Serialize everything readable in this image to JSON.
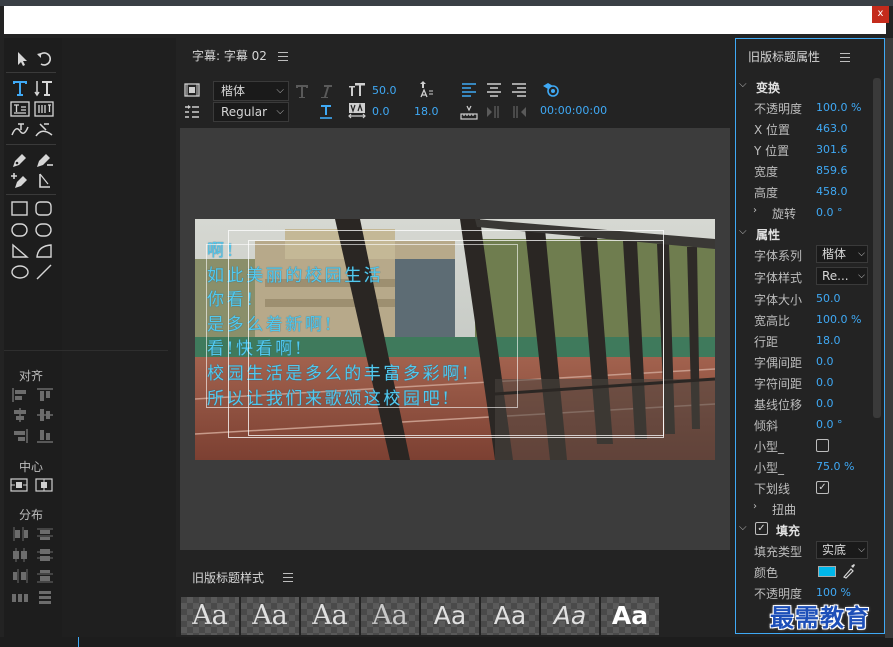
{
  "window": {
    "close_label": "x"
  },
  "editor": {
    "tab_label": "字幕: 字幕 02",
    "font_family": "楷体",
    "font_style": "Regular",
    "font_size": "50.0",
    "kerning": "0.0",
    "leading": "18.0",
    "timecode": "00:00:00:00"
  },
  "subtitle_lines": [
    "啊!",
    "如此美丽的校园生活",
    "你看!",
    "是多么着新啊!",
    "看!快看啊!",
    "校园生活是多么的丰富多彩啊!",
    "所以让我们来歌颂这校园吧!"
  ],
  "left_panel": {
    "align_label": "对齐",
    "center_label": "中心",
    "distribute_label": "分布"
  },
  "styles": {
    "title": "旧版标题样式",
    "swatch_text": "Aa"
  },
  "properties": {
    "title": "旧版标题属性",
    "transform": {
      "label": "变换",
      "opacity_label": "不透明度",
      "opacity": "100.0 %",
      "x_label": "X 位置",
      "x": "463.0",
      "y_label": "Y 位置",
      "y": "301.6",
      "width_label": "宽度",
      "width": "859.6",
      "height_label": "高度",
      "height": "458.0",
      "rotation_label": "旋转",
      "rotation": "0.0 °"
    },
    "attributes": {
      "label": "属性",
      "family_label": "字体系列",
      "family": "楷体",
      "style_label": "字体样式",
      "style": "Re...",
      "size_label": "字体大小",
      "size": "50.0",
      "aspect_label": "宽高比",
      "aspect": "100.0 %",
      "leading_label": "行距",
      "leading": "18.0",
      "kerning_label": "字偶间距",
      "kerning": "0.0",
      "tracking_label": "字符间距",
      "tracking": "0.0",
      "baseline_label": "基线位移",
      "baseline": "0.0",
      "slant_label": "倾斜",
      "slant": "0.0 °",
      "smallcaps_label": "小型_",
      "smallcaps_size_label": "小型_",
      "smallcaps_size": "75.0 %",
      "underline_label": "下划线",
      "distort_label": "扭曲"
    },
    "fill": {
      "label": "填充",
      "type_label": "填充类型",
      "type": "实底",
      "color_label": "颜色",
      "color": "#00b7eb",
      "opacity_label": "不透明度",
      "opacity": "100 %"
    }
  },
  "watermark": "最需教育",
  "colors": {
    "accent": "#3fa9f5",
    "subtitle": "#52c9ee",
    "fill": "#00b7eb"
  }
}
